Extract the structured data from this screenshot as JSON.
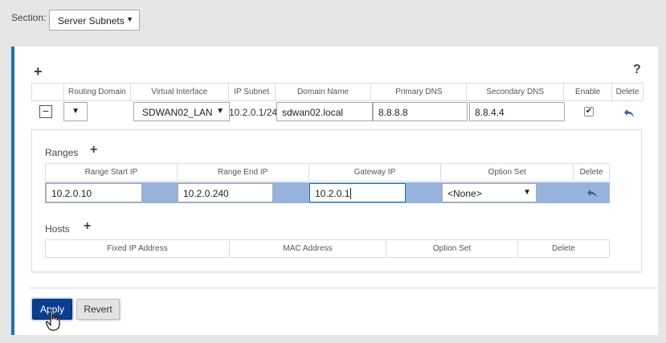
{
  "section": {
    "label": "Section:",
    "selected": "Server Subnets"
  },
  "main_table": {
    "add_symbol": "+",
    "help_symbol": "?",
    "headers": [
      "Routing Domain",
      "Virtual Interface",
      "IP Subnet",
      "Domain Name",
      "Primary DNS",
      "Secondary DNS",
      "Enable",
      "Delete"
    ],
    "row": {
      "collapse_symbol": "−",
      "routing_domain": "",
      "virtual_interface": "SDWAN02_LAN",
      "ip_subnet": "10.2.0.1/24",
      "domain_name": "sdwan02.local",
      "primary_dns": "8.8.8.8",
      "secondary_dns": "8.8.4.4",
      "enabled": true
    }
  },
  "ranges": {
    "title": "Ranges",
    "add_symbol": "+",
    "headers": [
      "Range Start IP",
      "Range End IP",
      "Gateway IP",
      "Option Set",
      "Delete"
    ],
    "row": {
      "start_ip": "10.2.0.10",
      "end_ip": "10.2.0.240",
      "gateway_ip": "10.2.0.1",
      "option_set": "<None>"
    }
  },
  "hosts": {
    "title": "Hosts",
    "add_symbol": "+",
    "headers": [
      "Fixed IP Address",
      "MAC Address",
      "Option Set",
      "Delete"
    ]
  },
  "buttons": {
    "apply": "Apply",
    "revert": "Revert"
  },
  "colors": {
    "accent": "#1f6fbf",
    "apply_bg": "#0b3e8f",
    "row_highlight": "#97b3dc"
  }
}
